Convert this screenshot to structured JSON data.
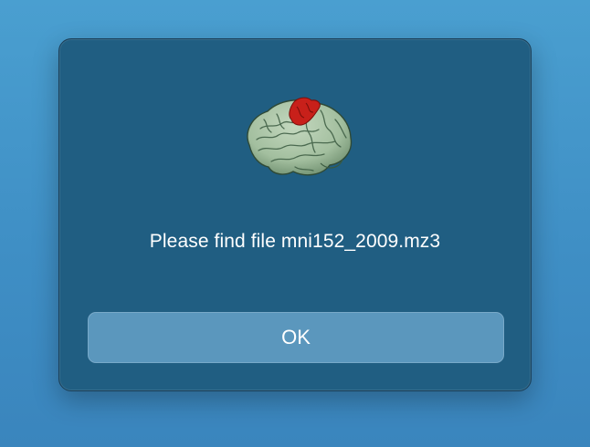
{
  "dialog": {
    "icon": "brain-icon",
    "message": "Please find file mni152_2009.mz3",
    "ok_label": "OK"
  },
  "colors": {
    "background": "#4a9fd0",
    "dialog_background": "#205e82",
    "button_background": "#5b97bd",
    "brain_surface": "#a8c2a4",
    "brain_highlight": "#c8201a"
  }
}
